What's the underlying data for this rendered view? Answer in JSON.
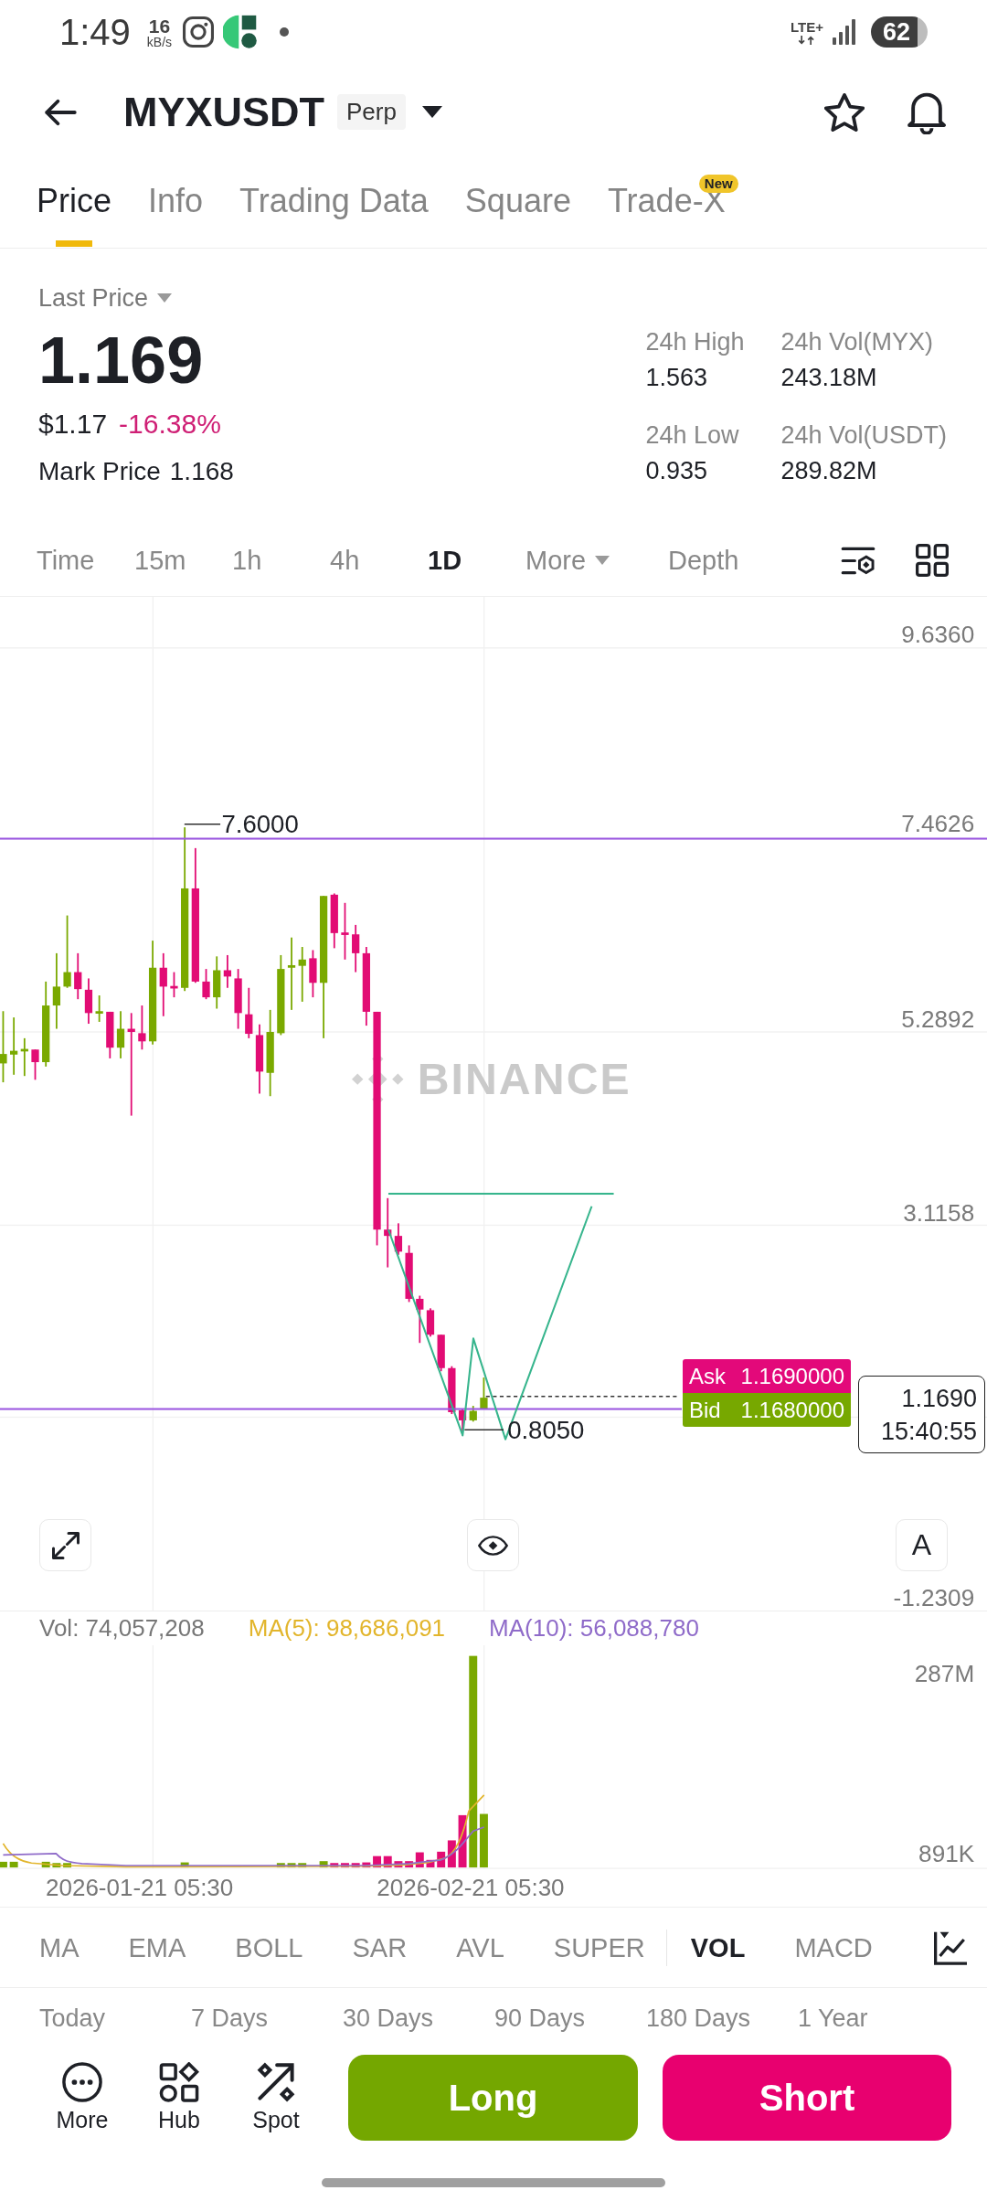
{
  "status_bar": {
    "time": "1:49",
    "net_speed_value": "16",
    "net_speed_unit": "kB/s",
    "network_type": "LTE+",
    "battery": "62"
  },
  "header": {
    "symbol": "MYXUSDT",
    "contract_badge": "Perp"
  },
  "tabs": [
    {
      "label": "Price",
      "selected": true
    },
    {
      "label": "Info",
      "selected": false
    },
    {
      "label": "Trading Data",
      "selected": false
    },
    {
      "label": "Square",
      "selected": false
    },
    {
      "label": "Trade-X",
      "selected": false,
      "badge": "New"
    }
  ],
  "price": {
    "label": "Last Price",
    "last": "1.169",
    "usd": "$1.17",
    "change": "-16.38%",
    "falling": true,
    "mark_label": "Mark Price",
    "mark": "1.168"
  },
  "stats": [
    {
      "label": "24h High",
      "value": "1.563"
    },
    {
      "label": "24h Vol(MYX)",
      "value": "243.18M"
    },
    {
      "label": "24h Low",
      "value": "0.935"
    },
    {
      "label": "24h Vol(USDT)",
      "value": "289.82M"
    }
  ],
  "intervals": [
    {
      "label": "Time",
      "kind": "option",
      "selected": false
    },
    {
      "label": "15m",
      "kind": "option",
      "selected": false
    },
    {
      "label": "1h",
      "kind": "option",
      "selected": false
    },
    {
      "label": "4h",
      "kind": "option",
      "selected": false
    },
    {
      "label": "1D",
      "kind": "option",
      "selected": true
    },
    {
      "label": "More",
      "kind": "menu",
      "selected": false
    },
    {
      "label": "Depth",
      "kind": "option",
      "selected": false
    }
  ],
  "chart": {
    "price_ticks": [
      "9.6360",
      "7.4626",
      "5.2892",
      "3.1158",
      "-1.2309"
    ],
    "high_label": "7.6000",
    "low_label": "0.8050",
    "logo_text": "BINANCE",
    "quote_tags": [
      {
        "kind": "ask",
        "label": "Ask",
        "value": "1.1690000"
      },
      {
        "kind": "bid",
        "label": "Bid",
        "value": "1.1680000"
      }
    ],
    "last_price": "1.1690",
    "countdown": "15:40:55",
    "scale_button": "A"
  },
  "volume": {
    "legend": [
      {
        "label": "Vol: 74,057,208",
        "color": "#777777"
      },
      {
        "label": "MA(5): 98,686,091",
        "color": "#e2b52c"
      },
      {
        "label": "MA(10): 56,088,780",
        "color": "#8f6bc9"
      }
    ],
    "ticks": [
      "287M",
      "891K"
    ],
    "dates": [
      "2026-01-21 05:30",
      "2026-02-21 05:30"
    ]
  },
  "indicators": {
    "main": [
      {
        "label": "MA",
        "selected": false
      },
      {
        "label": "EMA",
        "selected": false
      },
      {
        "label": "BOLL",
        "selected": false
      },
      {
        "label": "SAR",
        "selected": false
      },
      {
        "label": "AVL",
        "selected": false
      },
      {
        "label": "SUPER",
        "selected": false
      }
    ],
    "sub": [
      {
        "label": "VOL",
        "selected": true
      },
      {
        "label": "MACD",
        "selected": false
      }
    ]
  },
  "ranges": [
    {
      "label": "Today",
      "selected": false
    },
    {
      "label": "7 Days",
      "selected": false
    },
    {
      "label": "30 Days",
      "selected": false
    },
    {
      "label": "90 Days",
      "selected": false
    },
    {
      "label": "180 Days",
      "selected": false
    },
    {
      "label": "1 Year",
      "selected": false
    }
  ],
  "actions": {
    "tools": [
      {
        "label": "More",
        "kind": "more"
      },
      {
        "label": "Hub",
        "kind": "hub"
      },
      {
        "label": "Spot",
        "kind": "spot"
      }
    ],
    "long": "Long",
    "short": "Short"
  }
}
